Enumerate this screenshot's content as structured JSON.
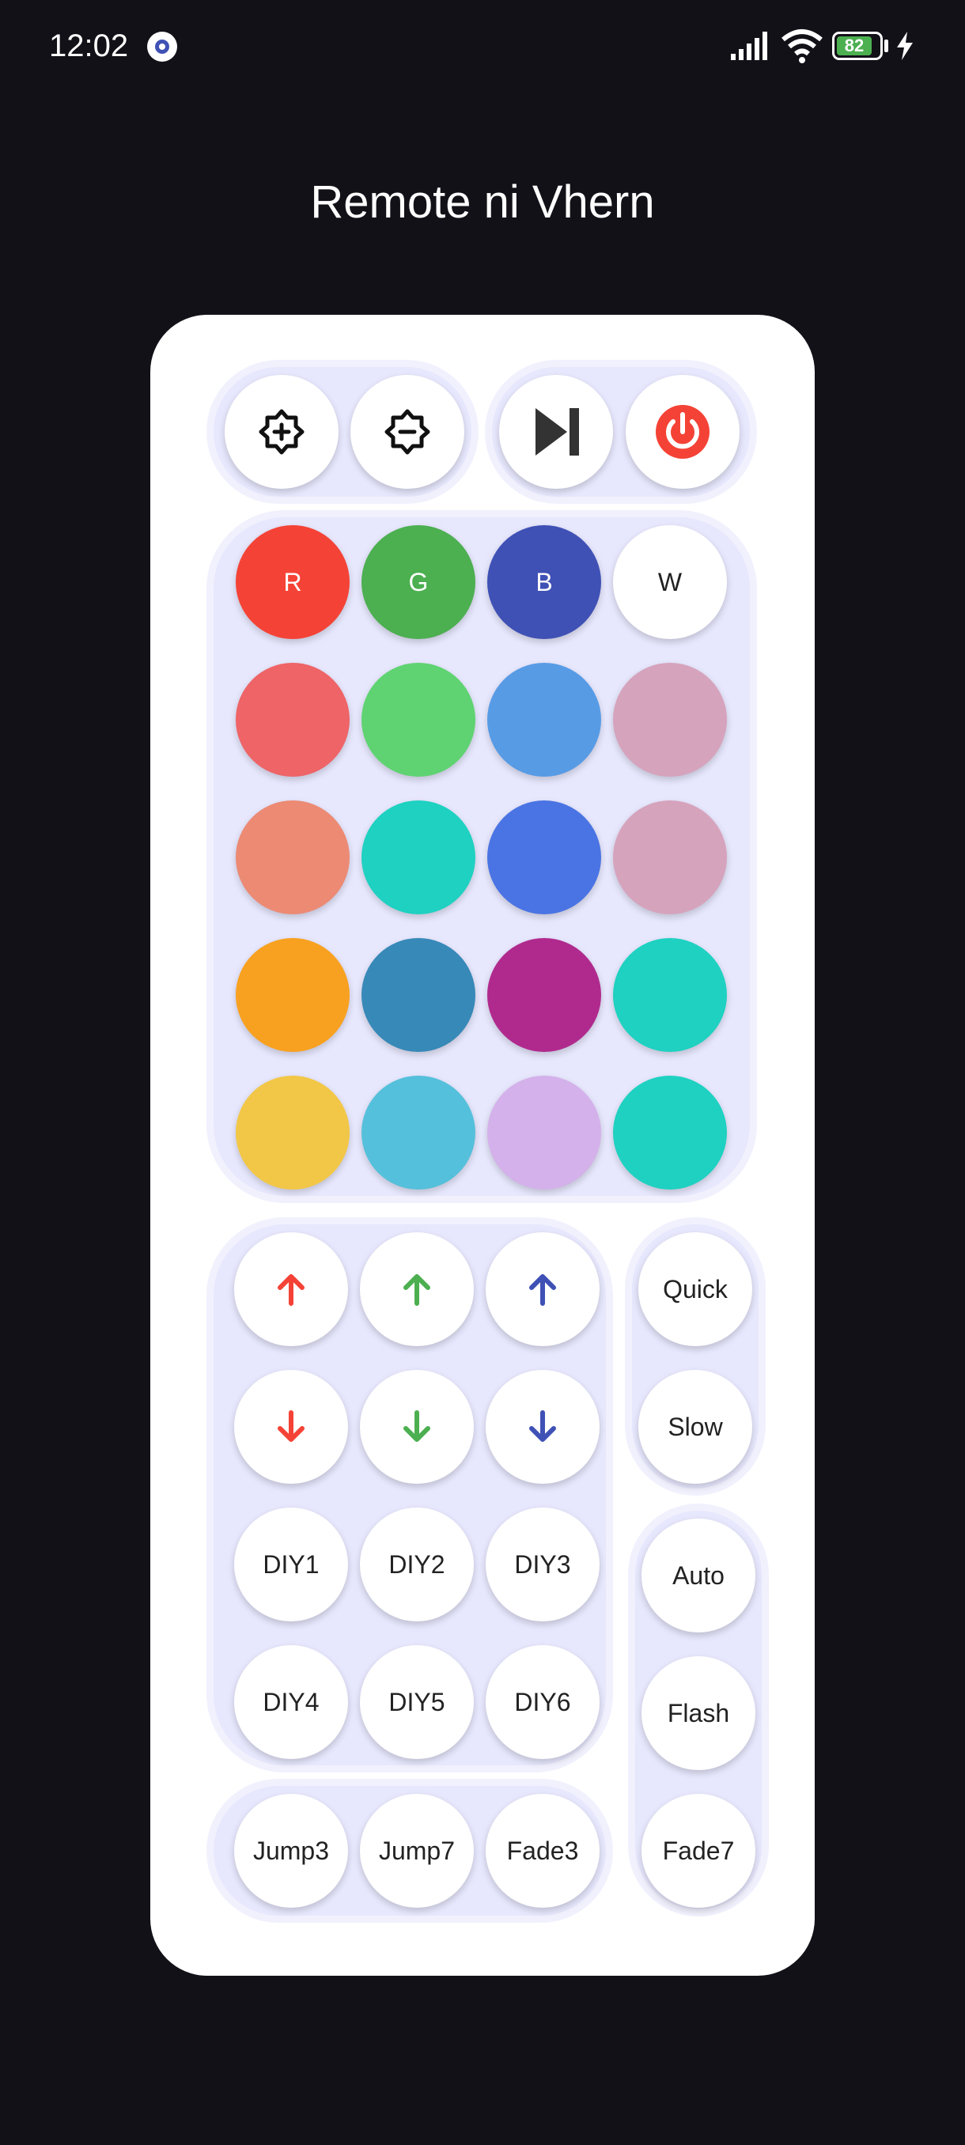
{
  "status_bar": {
    "time": "12:02",
    "battery": "82"
  },
  "app": {
    "title": "Remote ni Vhern"
  },
  "top_controls": {
    "icons": [
      "brightness-up-icon",
      "brightness-down-icon",
      "skip-next-icon",
      "power-icon"
    ]
  },
  "color_grid": {
    "row1": [
      {
        "label": "R",
        "color": "#F44336"
      },
      {
        "label": "G",
        "color": "#4CAF50"
      },
      {
        "label": "B",
        "color": "#3F51B5"
      },
      {
        "label": "W",
        "color": "#FFFFFF"
      }
    ],
    "rows": [
      [
        "#EE6467",
        "#5FD372",
        "#589BE5",
        "#D6A3BC"
      ],
      [
        "#EC8A74",
        "#1ED1C1",
        "#4A74E3",
        "#D6A3BC"
      ],
      [
        "#F8A120",
        "#3789B8",
        "#B02A8E",
        "#1ED1C1"
      ],
      [
        "#F2C747",
        "#55C0DB",
        "#D4B1EA",
        "#1ED1C1"
      ]
    ]
  },
  "adjust": {
    "up_colors": [
      "#F44336",
      "#4CAF50",
      "#3F51B5"
    ],
    "down_colors": [
      "#F44336",
      "#4CAF50",
      "#3F51B5"
    ],
    "up_icons": [
      "red-up-arrow-icon",
      "green-up-arrow-icon",
      "blue-up-arrow-icon"
    ],
    "down_icons": [
      "red-down-arrow-icon",
      "green-down-arrow-icon",
      "blue-down-arrow-icon"
    ]
  },
  "diy": [
    "DIY1",
    "DIY2",
    "DIY3",
    "DIY4",
    "DIY5",
    "DIY6"
  ],
  "speed": [
    "Quick",
    "Slow"
  ],
  "modes": [
    "Auto",
    "Flash",
    "Fade7"
  ],
  "jumps": [
    "Jump3",
    "Jump7",
    "Fade3"
  ]
}
